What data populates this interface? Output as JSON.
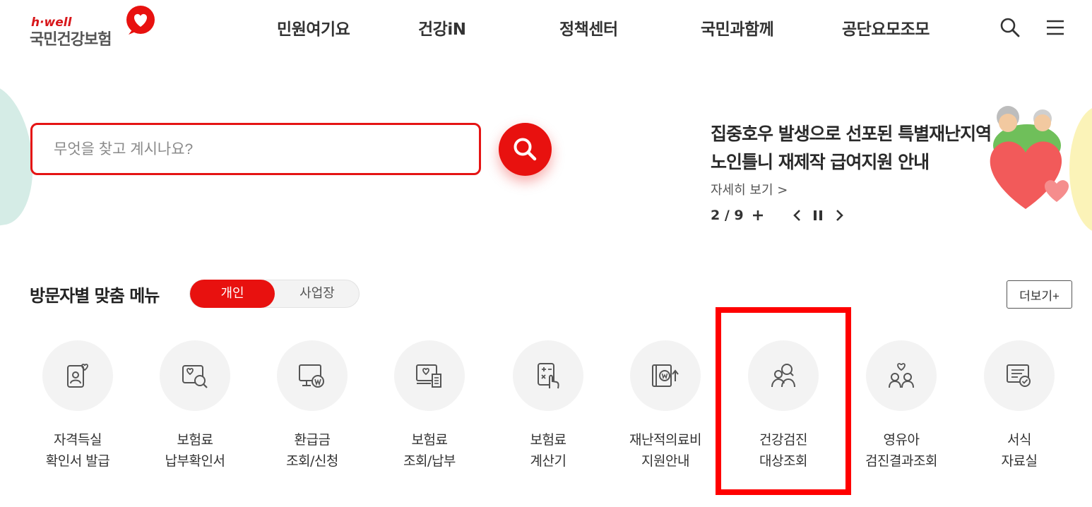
{
  "header": {
    "logo_text": "h·well",
    "logo_name": "국민건강보험",
    "nav": [
      "민원여기요",
      "건강iN",
      "정책센터",
      "국민과함께",
      "공단요모조모"
    ]
  },
  "search": {
    "placeholder": "무엇을 찾고 계시나요?"
  },
  "banner": {
    "title_line1": "집중호우 발생으로 선포된 특별재난지역",
    "title_line2": "노인틀니 재제작 급여지원 안내",
    "more_link": "자세히 보기 >",
    "counter": "2 / 9",
    "plus": "+"
  },
  "visitor_menu": {
    "title": "방문자별 맞춤 메뉴",
    "toggle_on": "개인",
    "toggle_off": "사업장",
    "more_button": "더보기+",
    "items": [
      {
        "line1": "자격득실",
        "line2": "확인서 발급",
        "icon": "id-card-heart-icon"
      },
      {
        "line1": "보험료",
        "line2": "납부확인서",
        "icon": "document-search-icon"
      },
      {
        "line1": "환급금",
        "line2": "조회/신청",
        "icon": "monitor-won-icon"
      },
      {
        "line1": "보험료",
        "line2": "조회/납부",
        "icon": "monitor-receipt-icon"
      },
      {
        "line1": "보험료",
        "line2": "계산기",
        "icon": "calculator-hand-icon"
      },
      {
        "line1": "재난적의료비",
        "line2": "지원안내",
        "icon": "book-won-icon"
      },
      {
        "line1": "건강검진",
        "line2": "대상조회",
        "icon": "people-search-icon"
      },
      {
        "line1": "영유아",
        "line2": "검진결과조회",
        "icon": "family-heart-icon"
      },
      {
        "line1": "서식",
        "line2": "자료실",
        "icon": "form-check-icon"
      }
    ]
  },
  "highlight_color": "#ff0000",
  "accent_color": "#e8110f"
}
